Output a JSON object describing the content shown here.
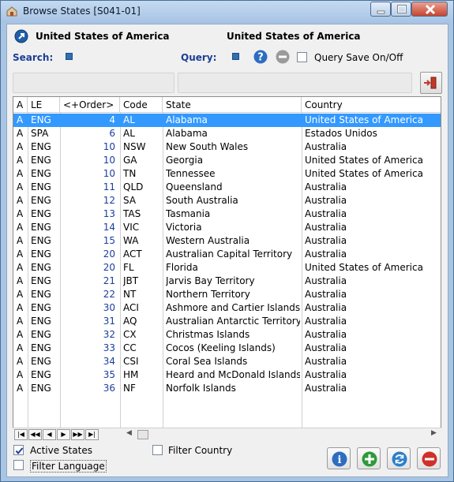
{
  "window": {
    "title": "Browse States [S041-01]"
  },
  "header": {
    "country_left": "United States of America",
    "country_right": "United States of America"
  },
  "search": {
    "label": "Search:"
  },
  "query": {
    "label": "Query:",
    "save_label": "Query Save On/Off"
  },
  "columns": [
    "A",
    "LE",
    "<+Order>",
    "Code",
    "State",
    "Country"
  ],
  "rows": [
    {
      "a": "A",
      "le": "ENG",
      "order": "4",
      "code": "AL",
      "state": "Alabama",
      "country": "United States of America"
    },
    {
      "a": "A",
      "le": "SPA",
      "order": "6",
      "code": "AL",
      "state": "Alabama",
      "country": "Estados Unidos"
    },
    {
      "a": "A",
      "le": "ENG",
      "order": "10",
      "code": "NSW",
      "state": "New South Wales",
      "country": "Australia"
    },
    {
      "a": "A",
      "le": "ENG",
      "order": "10",
      "code": "GA",
      "state": "Georgia",
      "country": "United States of America"
    },
    {
      "a": "A",
      "le": "ENG",
      "order": "10",
      "code": "TN",
      "state": "Tennessee",
      "country": "United States of America"
    },
    {
      "a": "A",
      "le": "ENG",
      "order": "11",
      "code": "QLD",
      "state": "Queensland",
      "country": "Australia"
    },
    {
      "a": "A",
      "le": "ENG",
      "order": "12",
      "code": "SA",
      "state": "South Australia",
      "country": "Australia"
    },
    {
      "a": "A",
      "le": "ENG",
      "order": "13",
      "code": "TAS",
      "state": "Tasmania",
      "country": "Australia"
    },
    {
      "a": "A",
      "le": "ENG",
      "order": "14",
      "code": "VIC",
      "state": "Victoria",
      "country": "Australia"
    },
    {
      "a": "A",
      "le": "ENG",
      "order": "15",
      "code": "WA",
      "state": "Western Australia",
      "country": "Australia"
    },
    {
      "a": "A",
      "le": "ENG",
      "order": "20",
      "code": "ACT",
      "state": "Australian Capital Territory",
      "country": "Australia"
    },
    {
      "a": "A",
      "le": "ENG",
      "order": "20",
      "code": "FL",
      "state": "Florida",
      "country": "United States of America"
    },
    {
      "a": "A",
      "le": "ENG",
      "order": "21",
      "code": "JBT",
      "state": "Jarvis Bay Territory",
      "country": "Australia"
    },
    {
      "a": "A",
      "le": "ENG",
      "order": "22",
      "code": "NT",
      "state": "Northern Territory",
      "country": "Australia"
    },
    {
      "a": "A",
      "le": "ENG",
      "order": "30",
      "code": "ACI",
      "state": "Ashmore and Cartier Islands",
      "country": "Australia"
    },
    {
      "a": "A",
      "le": "ENG",
      "order": "31",
      "code": "AQ",
      "state": "Australian Antarctic Territory",
      "country": "Australia"
    },
    {
      "a": "A",
      "le": "ENG",
      "order": "32",
      "code": "CX",
      "state": "Christmas Islands",
      "country": "Australia"
    },
    {
      "a": "A",
      "le": "ENG",
      "order": "33",
      "code": "CC",
      "state": "Cocos (Keeling Islands)",
      "country": "Australia"
    },
    {
      "a": "A",
      "le": "ENG",
      "order": "34",
      "code": "CSI",
      "state": "Coral Sea Islands",
      "country": "Australia"
    },
    {
      "a": "A",
      "le": "ENG",
      "order": "35",
      "code": "HM",
      "state": "Heard and McDonald Islands",
      "country": "Australia"
    },
    {
      "a": "A",
      "le": "ENG",
      "order": "36",
      "code": "NF",
      "state": "Norfolk Islands",
      "country": "Australia"
    }
  ],
  "selected_row": 0,
  "filters": {
    "active_states": "Active States",
    "active_states_checked": true,
    "filter_language": "Filter Language",
    "filter_language_checked": false,
    "filter_country": "Filter Country",
    "filter_country_checked": false
  },
  "icons": {
    "header": "go-arrow-icon",
    "help": "help-icon",
    "clear": "minus-gray-icon",
    "exit": "exit-door-icon",
    "info": "info-icon",
    "add": "add-icon",
    "refresh": "refresh-icon",
    "delete": "delete-icon"
  },
  "colors": {
    "selection": "#3399ff",
    "label_blue": "#1c3f94",
    "order_blue": "#1a3f9c"
  }
}
